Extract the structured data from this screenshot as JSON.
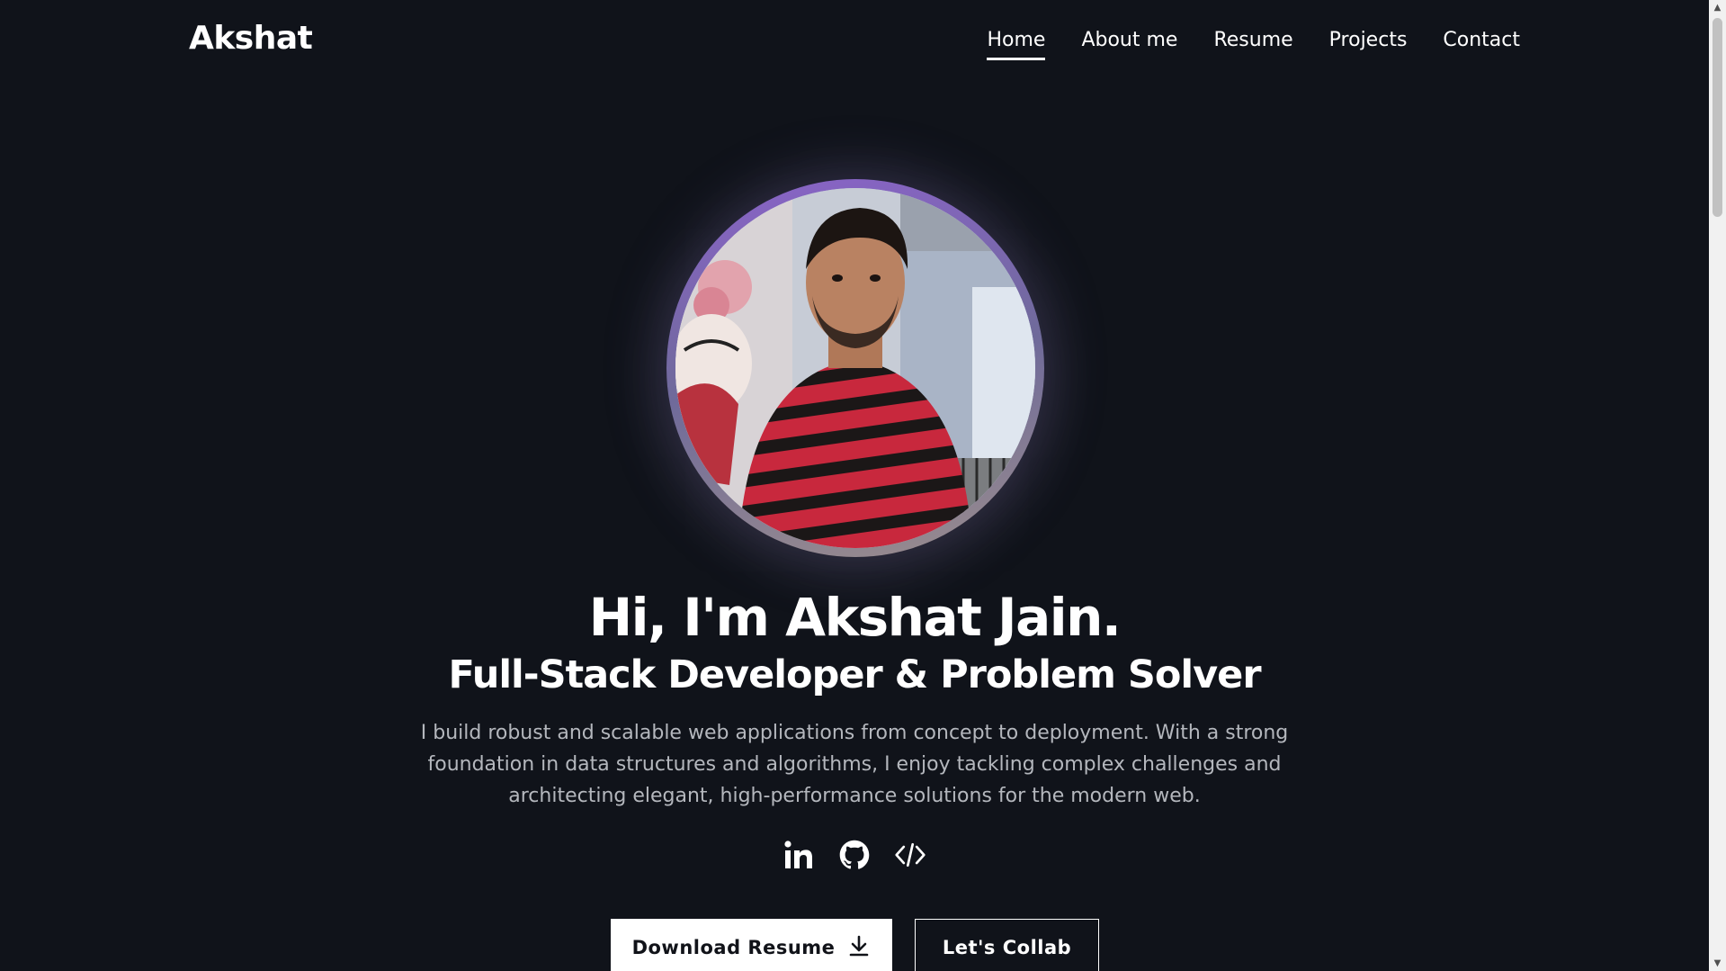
{
  "header": {
    "logo": "Akshat",
    "nav": [
      {
        "label": "Home",
        "active": true
      },
      {
        "label": "About me",
        "active": false
      },
      {
        "label": "Resume",
        "active": false
      },
      {
        "label": "Projects",
        "active": false
      },
      {
        "label": "Contact",
        "active": false
      }
    ]
  },
  "hero": {
    "avatar_alt": "profile-photo",
    "title": "Hi, I'm Akshat Jain.",
    "subtitle": "Full-Stack Developer & Problem Solver",
    "description": "I build robust and scalable web applications from concept to deployment. With a strong foundation in data structures and algorithms, I enjoy tackling complex challenges and architecting elegant, high-performance solutions for the modern web.",
    "socials": [
      {
        "icon": "linkedin-icon"
      },
      {
        "icon": "github-icon"
      },
      {
        "icon": "code-icon"
      }
    ],
    "primary_button": "Download Resume",
    "secondary_button": "Let's Collab"
  },
  "colors": {
    "background": "#10131a",
    "text": "#ffffff",
    "muted_text": "#b4b7bd",
    "avatar_ring": "#8a63c9"
  }
}
